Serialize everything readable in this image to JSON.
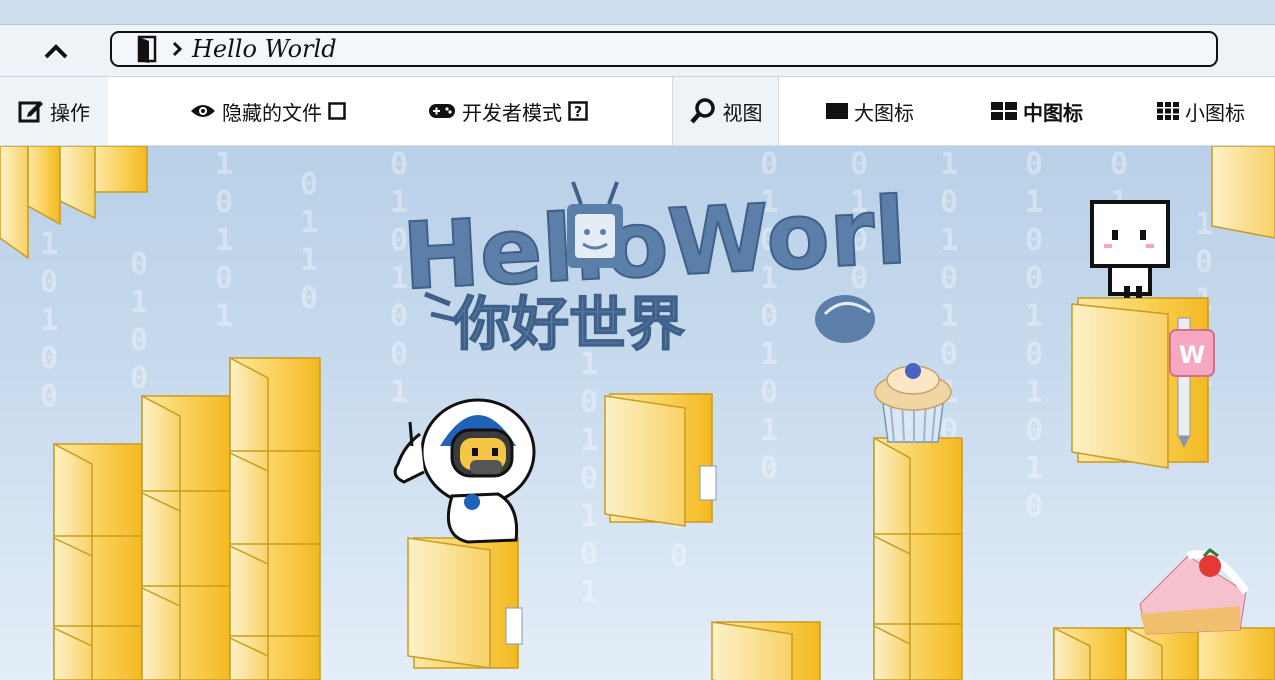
{
  "address": {
    "path_label": "Hello World"
  },
  "toolbar": {
    "actions_label": "操作",
    "hidden_files_label": "隐藏的文件",
    "developer_mode_label": "开发者模式",
    "view_label": "视图",
    "large_icons_label": "大图标",
    "medium_icons_label": "中图标",
    "small_icons_label": "小图标"
  },
  "wallpaper": {
    "title_text": "HelloWorld",
    "subtitle_text": "你好世界",
    "badge_letter": "W"
  },
  "colors": {
    "folder_yellow": "#f7c33a",
    "folder_light": "#fde8a4",
    "title_blue": "#5b7fa8",
    "background_top": "#b9d0e8"
  }
}
